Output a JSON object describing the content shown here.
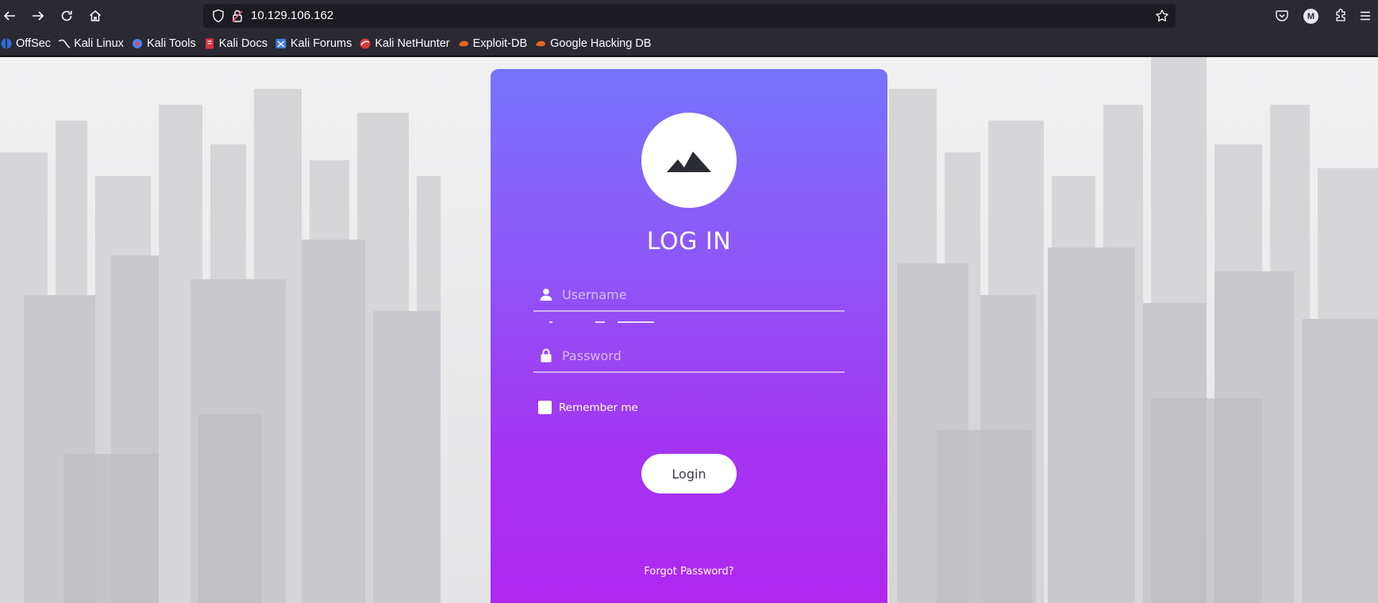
{
  "browser": {
    "url": "10.129.106.162",
    "profile_initial": "M",
    "bookmarks": [
      {
        "label": "OffSec",
        "icon": "offsec-icon"
      },
      {
        "label": "Kali Linux",
        "icon": "kali-dragon-icon"
      },
      {
        "label": "Kali Tools",
        "icon": "kali-tools-icon"
      },
      {
        "label": "Kali Docs",
        "icon": "kali-docs-icon"
      },
      {
        "label": "Kali Forums",
        "icon": "kali-forums-icon"
      },
      {
        "label": "Kali NetHunter",
        "icon": "nethunter-icon"
      },
      {
        "label": "Exploit-DB",
        "icon": "exploit-db-icon"
      },
      {
        "label": "Google Hacking DB",
        "icon": "ghdb-icon"
      }
    ]
  },
  "login": {
    "title": "LOG IN",
    "username_placeholder": "Username",
    "password_placeholder": "Password",
    "remember_label": "Remember me",
    "remember_checked": false,
    "button_label": "Login",
    "forgot_label": "Forgot Password?",
    "gradient_top": "#7873fd",
    "gradient_bottom": "#b225ee"
  }
}
